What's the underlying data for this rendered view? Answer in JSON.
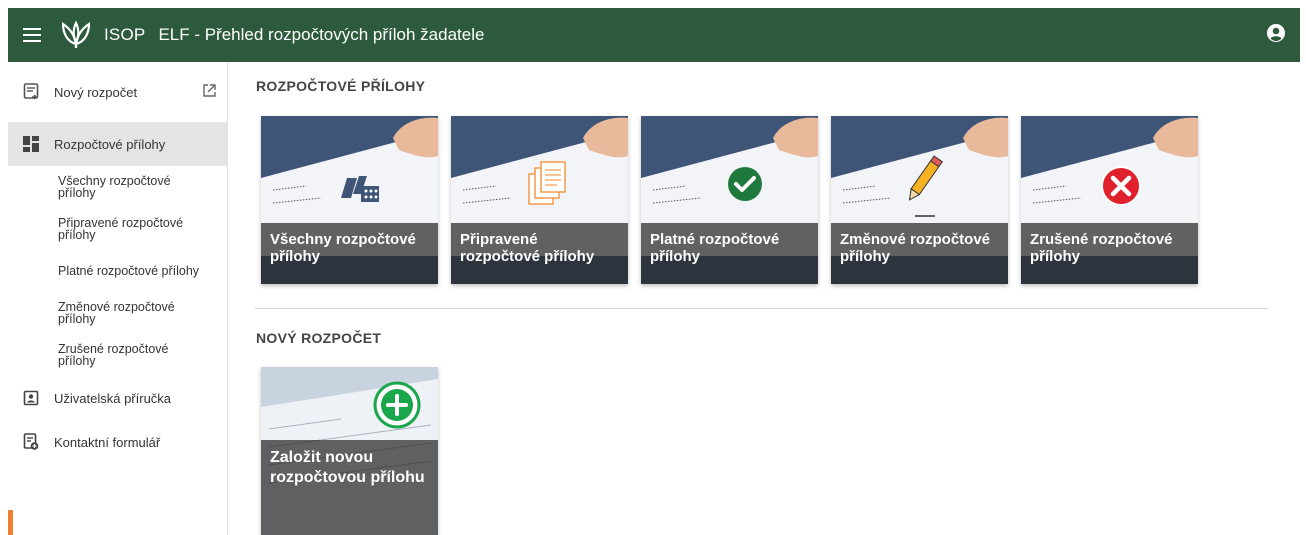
{
  "header": {
    "app_name": "ISOP",
    "title": "ELF - Přehled rozpočtových příloh žadatele",
    "background": "#2d5a3d"
  },
  "sidebar": {
    "items": [
      {
        "label": "Nový rozpočet",
        "icon": "document-arrow-icon"
      },
      {
        "label": "Rozpočtové přílohy",
        "icon": "dashboard-icon",
        "active": true
      },
      {
        "label": "Uživatelská příručka",
        "icon": "contact-book-icon"
      },
      {
        "label": "Kontaktní formulář",
        "icon": "form-add-icon"
      }
    ],
    "subitems": [
      "Všechny rozpočtové přílohy",
      "Připravené rozpočtové přílohy",
      "Platné rozpočtové přílohy",
      "Změnové rozpočtové přílohy",
      "Zrušené rozpočtové přílohy"
    ]
  },
  "main": {
    "section1_title": "ROZPOČTOVÉ PŘÍLOHY",
    "section2_title": "NOVÝ ROZPOČET",
    "cards": [
      {
        "label": "Všechny rozpočtové přílohy",
        "icon": "blocks-icon"
      },
      {
        "label": "Připravené rozpočtové přílohy",
        "icon": "document-stack-icon"
      },
      {
        "label": "Platné rozpočtové přílohy",
        "icon": "check-circle-icon",
        "color": "#1e7a3c"
      },
      {
        "label": "Změnové rozpočtové přílohy",
        "icon": "pencil-icon"
      },
      {
        "label": "Zrušené rozpočtové přílohy",
        "icon": "x-circle-icon",
        "color": "#e0202c"
      }
    ],
    "new_card": {
      "label": "Založit novou rozpočtovou přílohu",
      "icon": "plus-circle-icon",
      "color": "#1aa64b"
    }
  },
  "accent": "#f08030"
}
